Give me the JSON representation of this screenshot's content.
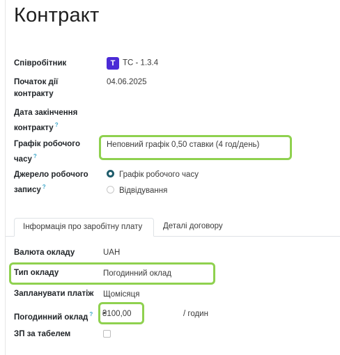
{
  "title": "Контракт",
  "employee": {
    "label": "Співробітник",
    "avatar": "T",
    "value": "TC - 1.3.4"
  },
  "start": {
    "label_line1": "Початок дії",
    "label_line2": "контракту",
    "value": "04.06.2025"
  },
  "end": {
    "label_line1": "Дата закінчення",
    "label_line2": "контракту",
    "help": "?"
  },
  "schedule": {
    "label_line1": "Графік робочого",
    "label_line2": "часу",
    "help": "?",
    "value": "Неповний графік 0,50 ставки (4 год/день)"
  },
  "source": {
    "label_line1": "Джерело робочого",
    "label_line2": "запису",
    "help": "?",
    "options": [
      {
        "label": "Графік робочого часу",
        "selected": true
      },
      {
        "label": "Відвідування",
        "selected": false
      }
    ]
  },
  "tabs": [
    {
      "label": "Інформація про заробітну плату",
      "active": true
    },
    {
      "label": "Деталі договору",
      "active": false
    }
  ],
  "salary": {
    "currency": {
      "label": "Валюта окладу",
      "value": "UAH"
    },
    "wage_type": {
      "label": "Тип окладу",
      "value": "Погодинний оклад"
    },
    "schedule_pay": {
      "label": "Запланувати платіж",
      "value": "Щомісяця"
    },
    "hourly_wage": {
      "label": "Погодинний оклад",
      "help": "?",
      "value": "₴100,00",
      "unit": "/ годин"
    },
    "timesheet": {
      "label": "ЗП за табелем",
      "checked": false
    }
  },
  "colors": {
    "highlight": "#8fd14f",
    "avatar": "#4b2bd6",
    "help": "#3aa5c9",
    "radio_selected": "#1f5c6b"
  }
}
